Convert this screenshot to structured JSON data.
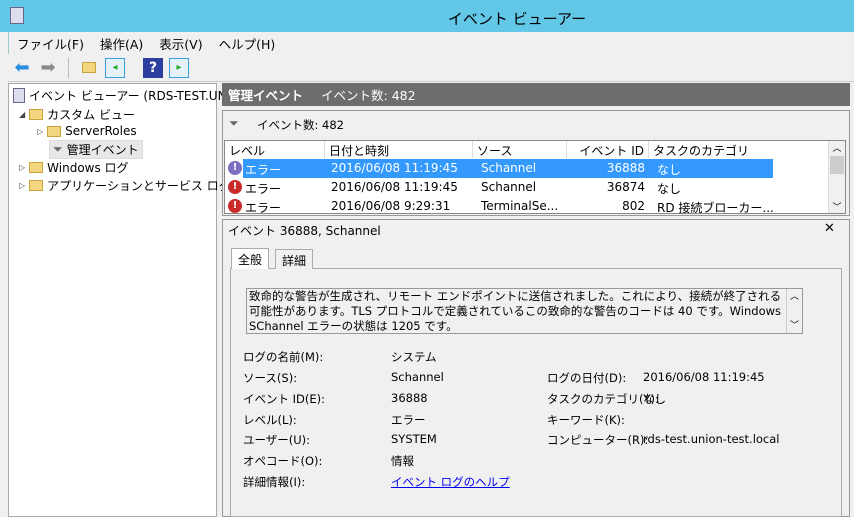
{
  "window": {
    "title": "イベント ビューアー"
  },
  "menu": [
    "ファイル(F)",
    "操作(A)",
    "表示(V)",
    "ヘルプ(H)"
  ],
  "tree": {
    "root": "イベント ビューアー (RDS-TEST.UNI",
    "custom_views": "カスタム ビュー",
    "server_roles": "ServerRoles",
    "admin_events": "管理イベント",
    "windows_logs": "Windows ログ",
    "app_logs": "アプリケーションとサービス ログ"
  },
  "header": {
    "title": "管理イベント",
    "count": "イベント数: 482"
  },
  "list": {
    "filter_count": "イベント数: 482",
    "columns": [
      "レベル",
      "日付と時刻",
      "ソース",
      "イベント ID",
      "タスクのカテゴリ"
    ],
    "rows": [
      {
        "level": "エラー",
        "date": "2016/06/08 11:19:45",
        "source": "Schannel",
        "id": "36888",
        "category": "なし"
      },
      {
        "level": "エラー",
        "date": "2016/06/08 11:19:45",
        "source": "Schannel",
        "id": "36874",
        "category": "なし"
      },
      {
        "level": "エラー",
        "date": "2016/06/08 9:29:31",
        "source": "TerminalSe...",
        "id": "802",
        "category": "RD 接続ブローカー..."
      }
    ]
  },
  "detail": {
    "title": "イベント 36888, Schannel",
    "tabs": [
      "全般",
      "詳細"
    ],
    "description": "致命的な警告が生成され、リモート エンドポイントに送信されました。これにより、接続が終了される可能性があります。TLS プロトコルで定義されているこの致命的な警告のコードは 40 です。Windows SChannel エラーの状態は 1205 です。",
    "fields": {
      "log_name_label": "ログの名前(M):",
      "log_name": "システム",
      "source_label": "ソース(S):",
      "source": "Schannel",
      "event_id_label": "イベント ID(E):",
      "event_id": "36888",
      "level_label": "レベル(L):",
      "level": "エラー",
      "user_label": "ユーザー(U):",
      "user": "SYSTEM",
      "opcode_label": "オペコード(O):",
      "opcode": "情報",
      "more_info_label": "詳細情報(I):",
      "more_info_link": "イベント ログのヘルプ",
      "logged_label": "ログの日付(D):",
      "logged": "2016/06/08 11:19:45",
      "task_label": "タスクのカテゴリ(Y):",
      "task": "なし",
      "keywords_label": "キーワード(K):",
      "computer_label": "コンピューター(R):",
      "computer": "rds-test.union-test.local"
    }
  }
}
